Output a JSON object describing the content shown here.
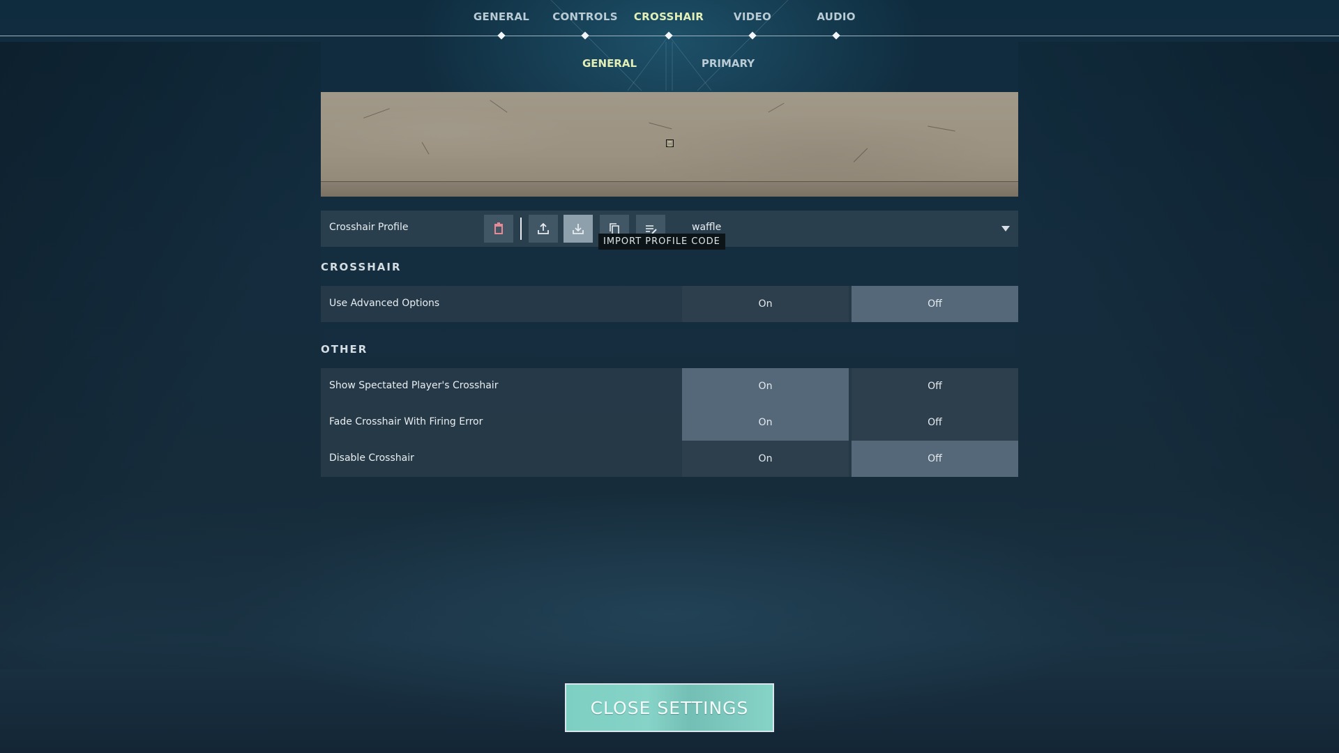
{
  "top_nav": {
    "tabs": [
      {
        "label": "GENERAL",
        "active": false
      },
      {
        "label": "CONTROLS",
        "active": false
      },
      {
        "label": "CROSSHAIR",
        "active": true
      },
      {
        "label": "VIDEO",
        "active": false
      },
      {
        "label": "AUDIO",
        "active": false
      }
    ]
  },
  "sub_nav": {
    "tabs": [
      {
        "label": "GENERAL",
        "active": true
      },
      {
        "label": "PRIMARY",
        "active": false
      }
    ]
  },
  "profile": {
    "label": "Crosshair Profile",
    "selected": "waffle",
    "actions": [
      {
        "icon": "trash-icon",
        "name": "delete-profile-button"
      },
      {
        "icon": "upload-icon",
        "name": "export-profile-button"
      },
      {
        "icon": "download-icon",
        "name": "import-profile-button"
      },
      {
        "icon": "copy-icon",
        "name": "duplicate-profile-button"
      },
      {
        "icon": "rename-icon",
        "name": "rename-profile-button"
      }
    ],
    "tooltip": "IMPORT PROFILE CODE"
  },
  "sections": {
    "crosshair": {
      "title": "CROSSHAIR",
      "rows": [
        {
          "label": "Use Advanced Options",
          "on_label": "On",
          "off_label": "Off",
          "value": "Off"
        }
      ]
    },
    "other": {
      "title": "OTHER",
      "rows": [
        {
          "label": "Show Spectated Player's Crosshair",
          "on_label": "On",
          "off_label": "Off",
          "value": "On"
        },
        {
          "label": "Fade Crosshair With Firing Error",
          "on_label": "On",
          "off_label": "Off",
          "value": "On"
        },
        {
          "label": "Disable Crosshair",
          "on_label": "On",
          "off_label": "Off",
          "value": "Off"
        }
      ]
    }
  },
  "close_button": {
    "label": "CLOSE SETTINGS"
  },
  "colors": {
    "active_tab": "#e2f0b8",
    "accent_button": "#7ecfc3",
    "selected_option": "#55687a",
    "delete_icon": "#e88a95"
  }
}
